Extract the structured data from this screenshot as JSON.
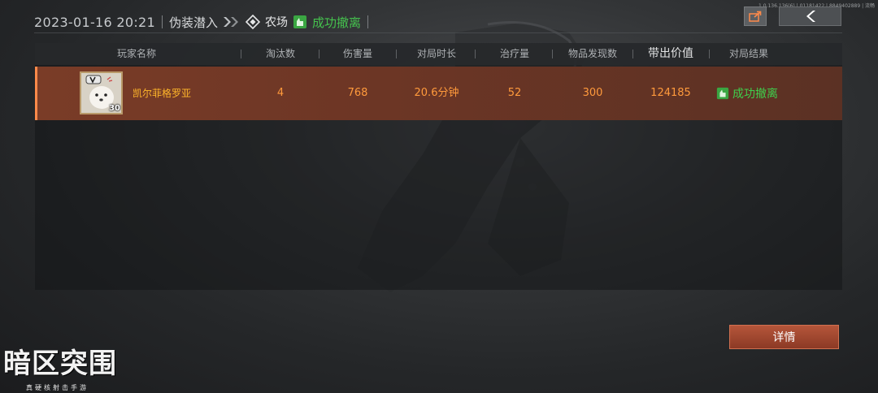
{
  "version_text": "1.0.136.136(6) | 01181422 | 8849402889 | 流畅",
  "header": {
    "datetime": "2023-01-16 20:21",
    "mode": "伪装潜入",
    "map": "农场",
    "status": "成功撤离"
  },
  "table": {
    "columns": [
      "玩家名称",
      "淘汰数",
      "伤害量",
      "对局时长",
      "治疗量",
      "物品发现数",
      "带出价值",
      "对局结果"
    ],
    "rows": [
      {
        "level": "30",
        "name": "凯尔菲格罗亚",
        "eliminations": "4",
        "damage": "768",
        "duration": "20.6分钟",
        "healing": "52",
        "items_found": "300",
        "extracted_value": "124185",
        "result": "成功撤离"
      }
    ]
  },
  "detail_button": "详情",
  "logo": {
    "title": "暗区突围",
    "subtitle": "真硬核射击手游"
  },
  "colors": {
    "success": "#45c24e",
    "row_value": "#ff9a3c",
    "player_name": "#ffb62a",
    "accent": "#ff8a4a",
    "detail_button": "#a84a32"
  }
}
